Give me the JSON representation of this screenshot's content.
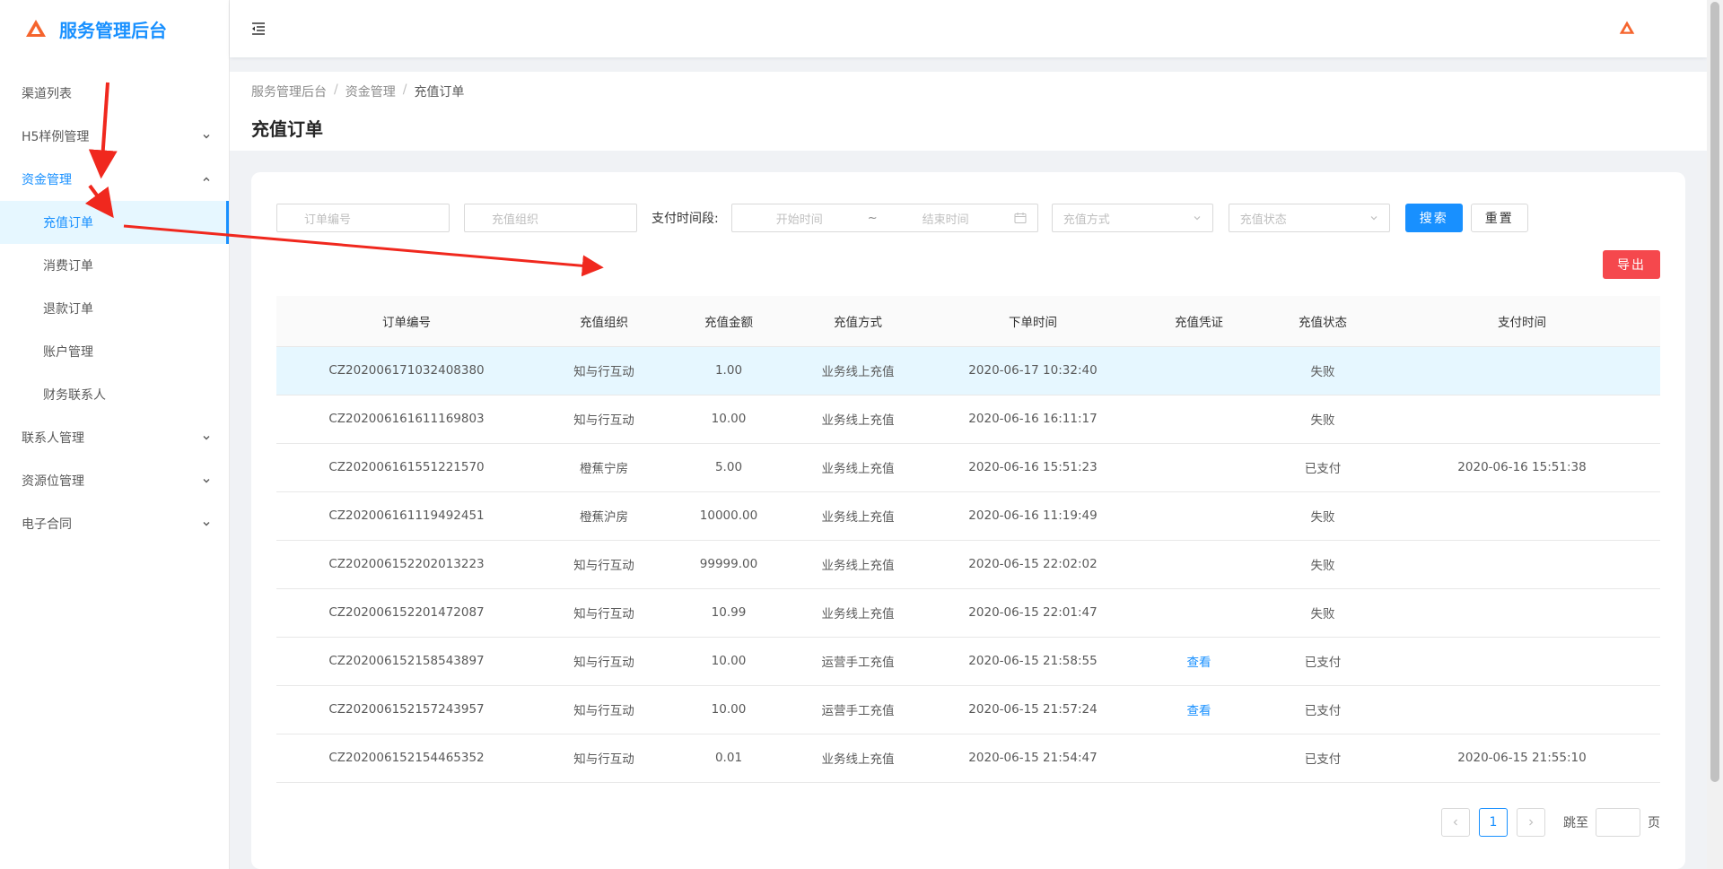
{
  "app": {
    "title": "服务管理后台"
  },
  "sidebar": {
    "items": [
      {
        "label": "渠道列表"
      },
      {
        "label": "H5样例管理"
      },
      {
        "label": "资金管理"
      },
      {
        "label": "充值订单"
      },
      {
        "label": "消费订单"
      },
      {
        "label": "退款订单"
      },
      {
        "label": "账户管理"
      },
      {
        "label": "财务联系人"
      },
      {
        "label": "联系人管理"
      },
      {
        "label": "资源位管理"
      },
      {
        "label": "电子合同"
      }
    ]
  },
  "breadcrumb": [
    "服务管理后台",
    "资金管理",
    "充值订单"
  ],
  "breadcrumb_sep": "/",
  "page": {
    "title": "充值订单"
  },
  "filters": {
    "order_placeholder": "订单编号",
    "org_placeholder": "充值组织",
    "pay_time_label": "支付时间段:",
    "start_placeholder": "开始时间",
    "range_sep": "~",
    "end_placeholder": "结束时间",
    "method_placeholder": "充值方式",
    "status_placeholder": "充值状态",
    "search_label": "搜索",
    "reset_label": "重置",
    "export_label": "导出"
  },
  "table": {
    "columns": [
      "订单编号",
      "充值组织",
      "充值金额",
      "充值方式",
      "下单时间",
      "充值凭证",
      "充值状态",
      "支付时间"
    ],
    "rows": [
      [
        "CZ202006171032408380",
        "知与行互动",
        "1.00",
        "业务线上充值",
        "2020-06-17 10:32:40",
        "",
        "失败",
        ""
      ],
      [
        "CZ202006161611169803",
        "知与行互动",
        "10.00",
        "业务线上充值",
        "2020-06-16 16:11:17",
        "",
        "失败",
        ""
      ],
      [
        "CZ202006161551221570",
        "橙蕉宁房",
        "5.00",
        "业务线上充值",
        "2020-06-16 15:51:23",
        "",
        "已支付",
        "2020-06-16 15:51:38"
      ],
      [
        "CZ202006161119492451",
        "橙蕉沪房",
        "10000.00",
        "业务线上充值",
        "2020-06-16 11:19:49",
        "",
        "失败",
        ""
      ],
      [
        "CZ202006152202013223",
        "知与行互动",
        "99999.00",
        "业务线上充值",
        "2020-06-15 22:02:02",
        "",
        "失败",
        ""
      ],
      [
        "CZ202006152201472087",
        "知与行互动",
        "10.99",
        "业务线上充值",
        "2020-06-15 22:01:47",
        "",
        "失败",
        ""
      ],
      [
        "CZ202006152158543897",
        "知与行互动",
        "10.00",
        "运营手工充值",
        "2020-06-15 21:58:55",
        "查看",
        "已支付",
        ""
      ],
      [
        "CZ202006152157243957",
        "知与行互动",
        "10.00",
        "运营手工充值",
        "2020-06-15 21:57:24",
        "查看",
        "已支付",
        ""
      ],
      [
        "CZ202006152154465352",
        "知与行互动",
        "0.01",
        "业务线上充值",
        "2020-06-15 21:54:47",
        "",
        "已支付",
        "2020-06-15 21:55:10"
      ]
    ]
  },
  "pagination": {
    "current": "1",
    "jump_label": "跳至",
    "page_suffix": "页"
  },
  "colors": {
    "accent": "#1890ff",
    "danger": "#f5484d",
    "logo": "#f5642d",
    "annotation": "#f0281e"
  }
}
